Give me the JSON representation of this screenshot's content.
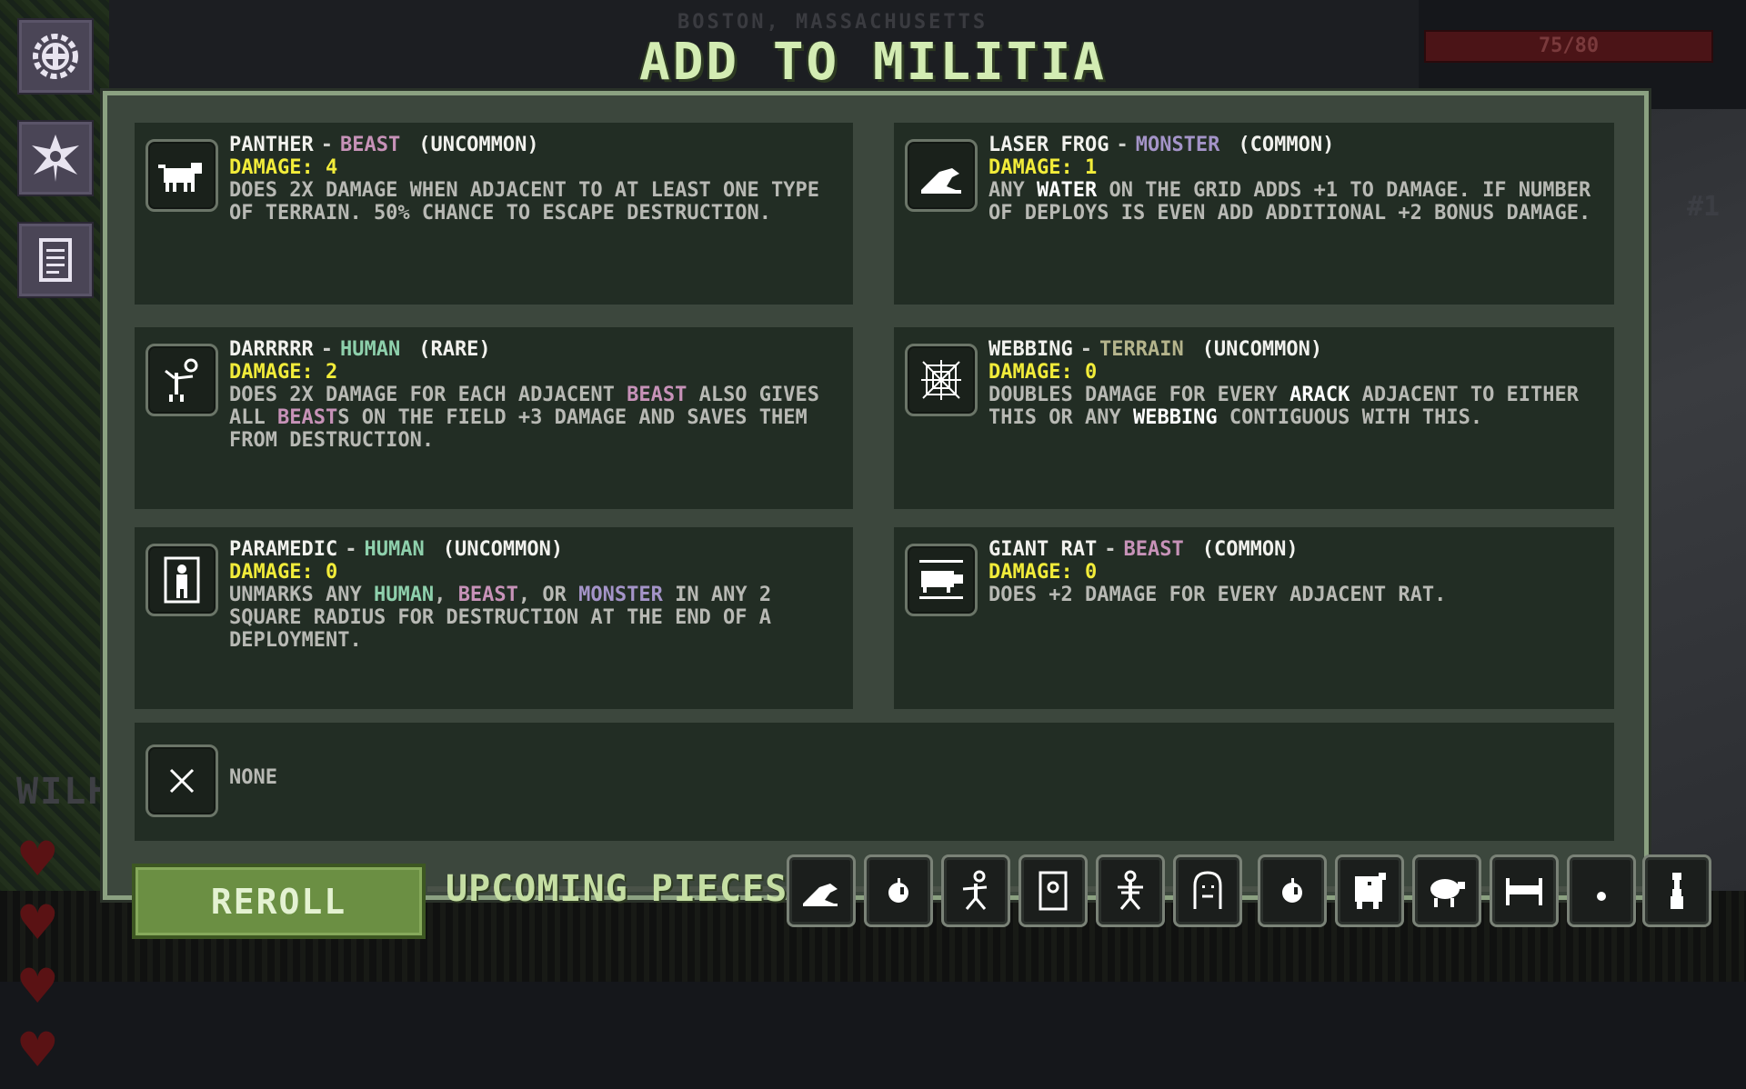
{
  "title": "ADD TO MILITIA",
  "background": {
    "location": "BOSTON, MASSACHUSETTS",
    "health": "75/80",
    "rank": "#1",
    "player_name": "WILH"
  },
  "tools": [
    {
      "icon": "gear-icon"
    },
    {
      "icon": "militia-emblem-icon"
    },
    {
      "icon": "document-icon"
    }
  ],
  "cards": [
    {
      "name": "PANTHER",
      "type": "BEAST",
      "rarity": "(UNCOMMON)",
      "damage_label": "DAMAGE: 4",
      "desc": "DOES 2X DAMAGE WHEN ADJACENT TO AT LEAST ONE TYPE OF TERRAIN. 50% CHANCE TO ESCAPE DESTRUCTION.",
      "icon": "panther-icon"
    },
    {
      "name": "LASER FROG",
      "type": "MONSTER",
      "rarity": "(COMMON)",
      "damage_label": "DAMAGE: 1",
      "desc_parts": [
        "ANY ",
        "WATER",
        " ON THE GRID ADDS +1 TO DAMAGE. IF NUMBER OF DEPLOYS IS EVEN ADD ADDITIONAL +2 BONUS DAMAGE."
      ],
      "icon": "frog-icon"
    },
    {
      "name": "DARRRRR",
      "type": "HUMAN",
      "rarity": "(RARE)",
      "damage_label": "DAMAGE: 2",
      "desc_parts": [
        "DOES 2X DAMAGE FOR EACH ADJACENT ",
        "BEAST",
        " ALSO GIVES ALL ",
        "BEAST",
        "S ON THE FIELD +3 DAMAGE AND SAVES THEM FROM DESTRUCTION."
      ],
      "icon": "pirate-icon"
    },
    {
      "name": "WEBBING",
      "type": "TERRAIN",
      "rarity": "(UNCOMMON)",
      "damage_label": "DAMAGE: 0",
      "desc_parts": [
        "DOUBLES DAMAGE FOR EVERY ",
        "ARACK",
        " ADJACENT TO EITHER THIS OR ANY ",
        "WEBBING",
        " CONTIGUOUS WITH THIS."
      ],
      "icon": "spider-web-icon"
    },
    {
      "name": "PARAMEDIC",
      "type": "HUMAN",
      "rarity": "(UNCOMMON)",
      "damage_label": "DAMAGE: 0",
      "desc_parts": [
        "UNMARKS ANY ",
        "HUMAN",
        ", ",
        "BEAST",
        ", OR ",
        "MONSTER",
        " IN ANY 2 SQUARE RADIUS FOR DESTRUCTION AT THE END OF A DEPLOYMENT."
      ],
      "icon": "paramedic-icon"
    },
    {
      "name": "GIANT RAT",
      "type": "BEAST",
      "rarity": "(COMMON)",
      "damage_label": "DAMAGE: 0",
      "desc": "DOES +2 DAMAGE FOR EVERY ADJACENT RAT.",
      "icon": "rat-icon"
    }
  ],
  "none_option": {
    "label": "NONE",
    "icon": "close-icon"
  },
  "reroll_label": "REROLL",
  "upcoming_label": "UPCOMING PIECES:",
  "upcoming": [
    {
      "icon": "frog-icon"
    },
    {
      "icon": "apple-icon"
    },
    {
      "icon": "runner-icon"
    },
    {
      "icon": "door-icon"
    },
    {
      "icon": "skeleton-icon"
    },
    {
      "icon": "ghost-icon"
    },
    {
      "icon": "apple-icon"
    },
    {
      "icon": "monster-icon"
    },
    {
      "icon": "sheep-icon"
    },
    {
      "icon": "bed-icon"
    },
    {
      "icon": "dot-icon"
    },
    {
      "icon": "tower-icon"
    }
  ]
}
